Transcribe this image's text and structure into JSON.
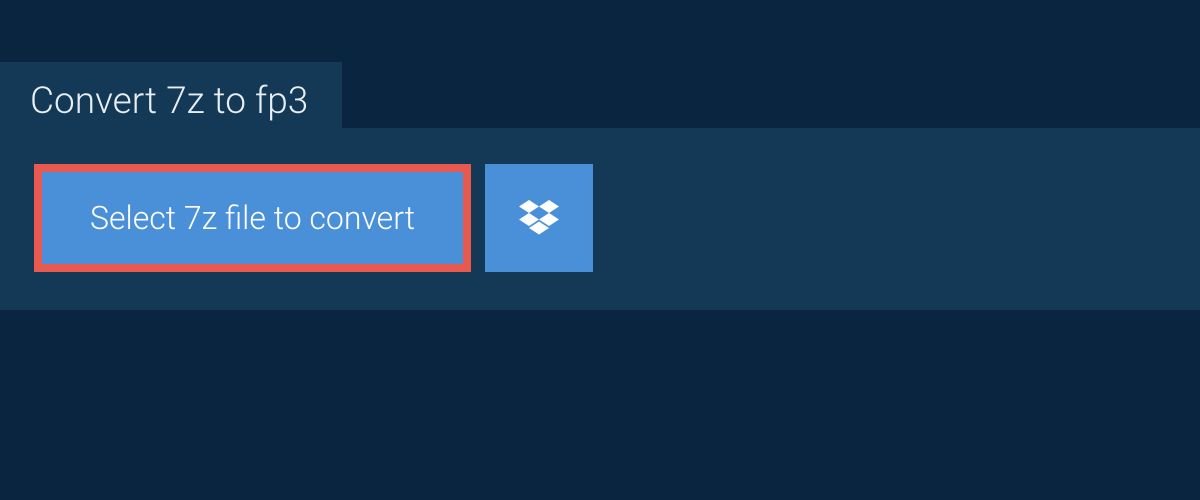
{
  "tab": {
    "title": "Convert 7z to fp3"
  },
  "buttons": {
    "select_file_label": "Select 7z file to convert"
  },
  "colors": {
    "background": "#0a2540",
    "panel": "#143957",
    "button": "#4a90d9",
    "highlight_border": "#e85a4f",
    "text_light": "#e8eef3"
  }
}
